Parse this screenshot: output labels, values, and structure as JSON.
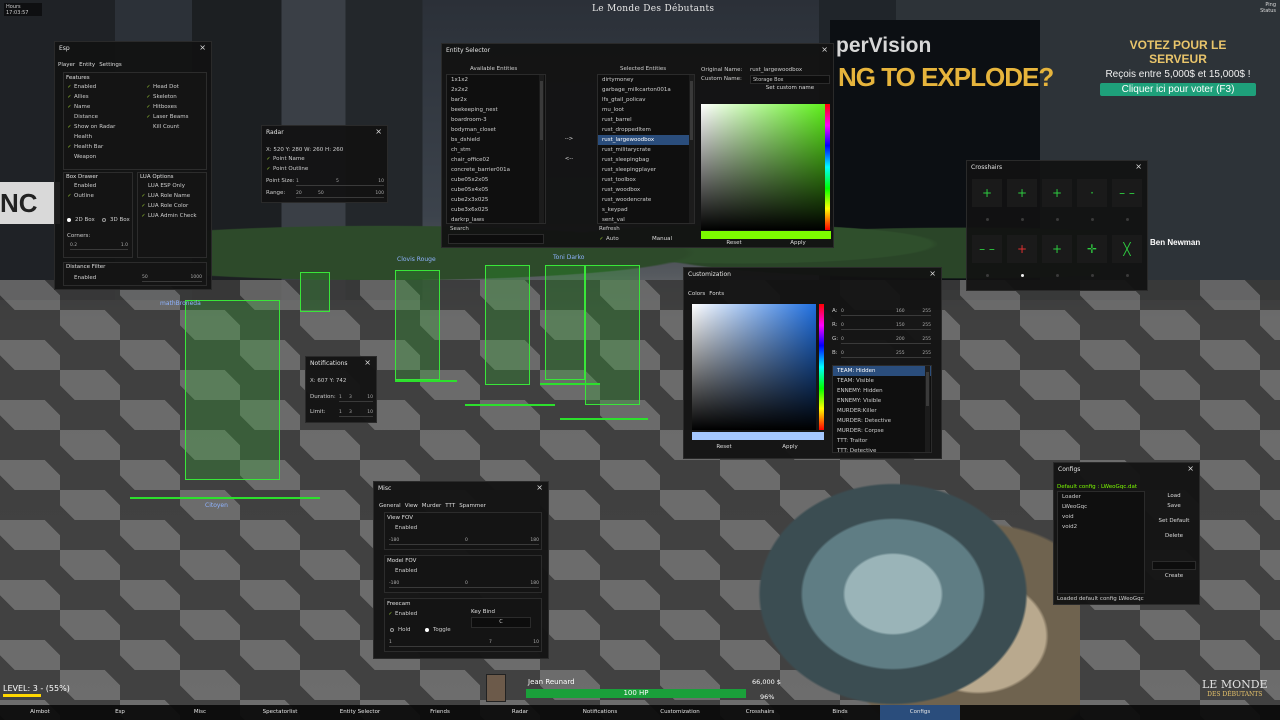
{
  "hud": {
    "clock_top": "Hours",
    "clock_time": "17:03:57",
    "server_title": "Le Monde Des Débutants",
    "top_right_line1": "Ping",
    "top_right_line2": "Status",
    "vote_title": "VOTEZ POUR LE SERVEUR",
    "vote_sub": "Reçois entre 5,000$ et 15,000$ !",
    "vote_btn": "Cliquer ici pour voter (F3)",
    "bb_left_text": "NC",
    "bb_mid_line1": "perVision",
    "bb_mid_line2": "NG TO EXPLODE?",
    "npc_names": [
      "mathBroneda",
      "Citoyen",
      "Clovis Rouge",
      "Toni Darko",
      "Ben Newman"
    ],
    "level": "LEVEL: 3 - (55%)",
    "player_name": "Jean Reunard",
    "hp": "100 HP",
    "money": "66,000 $",
    "armor": "96%",
    "logo1": "LE MONDE",
    "logo2": "DES DÉBUTANTS"
  },
  "esp": {
    "title": "Esp",
    "tabs": [
      "Player",
      "Entity",
      "Settings"
    ],
    "features_title": "Features",
    "features_left": [
      {
        "label": "Enabled",
        "checked": true
      },
      {
        "label": "Allies",
        "checked": true
      },
      {
        "label": "Name",
        "checked": true
      },
      {
        "label": "Distance",
        "checked": false
      },
      {
        "label": "Show on Radar",
        "checked": true
      },
      {
        "label": "Health",
        "checked": false
      },
      {
        "label": "Health Bar",
        "checked": true
      },
      {
        "label": "Weapon",
        "checked": false
      }
    ],
    "features_right": [
      {
        "label": "Head Dot",
        "checked": true
      },
      {
        "label": "Skeleton",
        "checked": true
      },
      {
        "label": "Hitboxes",
        "checked": true
      },
      {
        "label": "Laser Beams",
        "checked": true
      },
      {
        "label": "Kill Count",
        "checked": false
      }
    ],
    "box_title": "Box Drawer",
    "box_enabled": "Enabled",
    "box_outline": "Outline",
    "box_2d": "2D Box",
    "box_3d": "3D Box",
    "corners_label": "Corners:",
    "corners_min": "0.2",
    "corners_max": "1.0",
    "lua_title": "LUA Options",
    "lua_options": [
      {
        "label": "LUA ESP Only",
        "checked": false
      },
      {
        "label": "LUA Role Name",
        "checked": true
      },
      {
        "label": "LUA Role Color",
        "checked": true
      },
      {
        "label": "LUA Admin Check",
        "checked": true
      }
    ],
    "distance_title": "Distance Filter",
    "distance_enabled": "Enabled",
    "distance_value": "50",
    "distance_max": "1000"
  },
  "radar": {
    "title": "Radar",
    "coords": "X: 520 Y: 280 W: 260 H: 260",
    "point_name": "Point Name",
    "point_outline": "Point Outline",
    "point_size": "Point Size:",
    "point_size_min": "1",
    "point_size_val": "5",
    "point_size_max": "10",
    "range": "Range:",
    "range_min": "20",
    "range_val": "50",
    "range_max": "100"
  },
  "entity": {
    "title": "Entity Selector",
    "available_title": "Available Entities",
    "selected_title": "Selected Entities",
    "available": [
      "1x1x2",
      "2x2x2",
      "bar2x",
      "beekeeping_nest",
      "boardroom-3",
      "bodyman_closet",
      "bs_dshield",
      "ch_stm",
      "chair_office02",
      "concrete_barrier001a",
      "cube05x2x05",
      "cube05x4x05",
      "cube2x3x025",
      "cube3x6x025",
      "darkrp_laws"
    ],
    "selected": [
      "dirtymoney",
      "garbage_milkcarton001a",
      "lfs_gtaiI_policav",
      "mu_loot",
      "rust_barrel",
      "rust_droppedItem",
      "rust_largewoodbox",
      "rust_militarycrate",
      "rust_sleepingbag",
      "rust_sleepingplayer",
      "rust_toolbox",
      "rust_woodbox",
      "rust_woodencrate",
      "s_keypad",
      "sent_val"
    ],
    "selected_index": 6,
    "move_right": "-->",
    "move_left": "<--",
    "search_label": "Search",
    "refresh_label": "Refresh",
    "auto_label": "Auto",
    "manual_label": "Manual",
    "original_name_label": "Original Name:",
    "original_name": "rust_largewoodbox",
    "custom_name_label": "Custom Name:",
    "custom_name": "Storage Box",
    "set_custom_name": "Set custom name",
    "reset": "Reset",
    "apply": "Apply",
    "accent": "#7cfc00"
  },
  "crosshairs": {
    "title": "Crosshairs",
    "row1": [
      "+",
      "+",
      "+",
      "·",
      "– –"
    ],
    "row2": [
      "– –",
      "+",
      "+",
      "✛",
      "╳"
    ],
    "dots_row1_active": [
      false,
      false,
      false,
      false,
      false
    ],
    "dots_row2_active": [
      false,
      true,
      false,
      false,
      false
    ]
  },
  "customization": {
    "title": "Customization",
    "tabs": [
      "Colors",
      "Fonts"
    ],
    "sliders": [
      {
        "label": "A:",
        "min": "0",
        "val": "160",
        "max": "255"
      },
      {
        "label": "R:",
        "min": "0",
        "val": "150",
        "max": "255"
      },
      {
        "label": "G:",
        "min": "0",
        "val": "200",
        "max": "255"
      },
      {
        "label": "B:",
        "min": "0",
        "val": "255",
        "max": "255"
      }
    ],
    "items": [
      "TEAM: Hidden",
      "TEAM: Visible",
      "ENNEMY: Hidden",
      "ENNEMY: Visible",
      "MURDER:Killer",
      "MURDER: Detective",
      "MURDER: Corpse",
      "TTT: Traitor",
      "TTT: Detective"
    ],
    "selected_index": 0,
    "reset": "Reset",
    "apply": "Apply"
  },
  "notifications": {
    "title": "Notifications",
    "coords": "X: 607 Y: 742",
    "duration": "Duration:",
    "duration_min": "1",
    "duration_val": "3",
    "duration_max": "10",
    "limit": "Limit:",
    "limit_min": "1",
    "limit_val": "3",
    "limit_max": "10"
  },
  "misc": {
    "title": "Misc",
    "tabs": [
      "General",
      "View",
      "Murder",
      "TTT",
      "Spammer"
    ],
    "view_fov": "View FOV",
    "view_enabled": "Enabled",
    "view_min": "-180",
    "view_val": "0",
    "view_max": "180",
    "model_fov": "Model FOV",
    "model_enabled": "Enabled",
    "model_min": "-180",
    "model_val": "0",
    "model_max": "180",
    "freecam": "Freecam",
    "freecam_enabled": "Enabled",
    "hold": "Hold",
    "toggle": "Toggle",
    "keybind": "Key Bind",
    "keybind_val": "C",
    "freecam_min": "1",
    "freecam_val": "7",
    "freecam_max": "10"
  },
  "configs": {
    "title": "Configs",
    "default": "Default config : LWeoGqc.dat",
    "list": [
      "Loader",
      "LWeoGqc",
      "void",
      "void2"
    ],
    "load": "Load",
    "save": "Save",
    "set_default": "Set Default",
    "delete": "Delete",
    "create": "Create",
    "status": "Loaded default config LWeoGqc",
    "default_color": "#7cfc00"
  },
  "menubar": [
    "Aimbot",
    "Esp",
    "Misc",
    "Spectatorlist",
    "Entity Selector",
    "Friends",
    "Radar",
    "Notifications",
    "Customization",
    "Crosshairs",
    "Binds",
    "Configs"
  ],
  "menubar_active": 11
}
